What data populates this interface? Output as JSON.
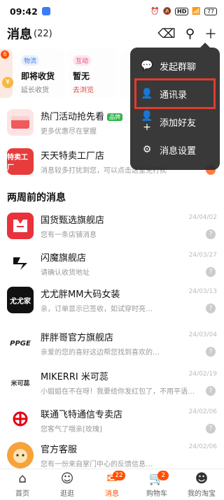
{
  "status_bar": {
    "time": "09:42",
    "network": "HD",
    "battery": "77"
  },
  "header": {
    "title": "消息",
    "count": "(22)"
  },
  "cards": [
    {
      "tag": "物流",
      "main": "即将收货",
      "sub": "延长收货"
    },
    {
      "tag": "互动",
      "main": "暂无",
      "sub": "去浏览"
    },
    {
      "tag": "",
      "main": "",
      "sub": ""
    }
  ],
  "card_badge": "6",
  "popup": {
    "items": [
      {
        "label": "发起群聊",
        "icon": "chat-icon"
      },
      {
        "label": "通讯录",
        "icon": "contacts-icon"
      },
      {
        "label": "添加好友",
        "icon": "add-friend-icon"
      },
      {
        "label": "消息设置",
        "icon": "settings-icon"
      }
    ]
  },
  "top_messages": [
    {
      "name": "热门活动抢先看",
      "badge": "品牌",
      "preview": "更多优惠尽在掌握"
    },
    {
      "name": "天天特卖工厂店",
      "preview": "消息较多打扰到您，可以点击这里免打扰",
      "avatar_text": "特卖工厂"
    }
  ],
  "section_title": "两周前的消息",
  "messages": [
    {
      "name": "国货甄选旗舰店",
      "preview": "您有一条店铺消息",
      "date": "24/04/02"
    },
    {
      "name": "闪魔旗舰店",
      "preview": "请确认收货地址",
      "date": "24/03/27"
    },
    {
      "name": "尤尤胖MM大码女装",
      "preview": "亲，订单显示已签收，如试穿时亮…",
      "date": "24/03/13",
      "avatar_text": "尤尤家"
    },
    {
      "name": "胖胖哥官方旗舰店",
      "preview": "亲爱的您的喜好这边帮您找到喜欢的…",
      "date": "24/03/04",
      "avatar_text": "PPGE"
    },
    {
      "name": "MIKERRI  米可蕊",
      "preview": "小姐姐在不在呀！我要给你发红包了，不用平语…",
      "date": "24/02/19",
      "avatar_text": "米可蕊"
    },
    {
      "name": "联通飞特通信专卖店",
      "preview": "您客气了哦亲[玫瑰]",
      "date": "24/02/06"
    },
    {
      "name": "官方客服",
      "preview": "您有一份来自掌门中心的反馈信息…",
      "date": "24/02/06"
    }
  ],
  "tabs": [
    {
      "label": "首页",
      "icon": "home-icon",
      "badge": ""
    },
    {
      "label": "逛逛",
      "icon": "explore-icon",
      "badge": ""
    },
    {
      "label": "消息",
      "icon": "message-icon",
      "badge": "22"
    },
    {
      "label": "购物车",
      "icon": "cart-icon",
      "badge": "2"
    },
    {
      "label": "我的淘宝",
      "icon": "profile-icon",
      "badge": ""
    }
  ],
  "colors": {
    "accent": "#ff5000",
    "highlight": "#e33b2e",
    "popup_bg": "#282828"
  }
}
